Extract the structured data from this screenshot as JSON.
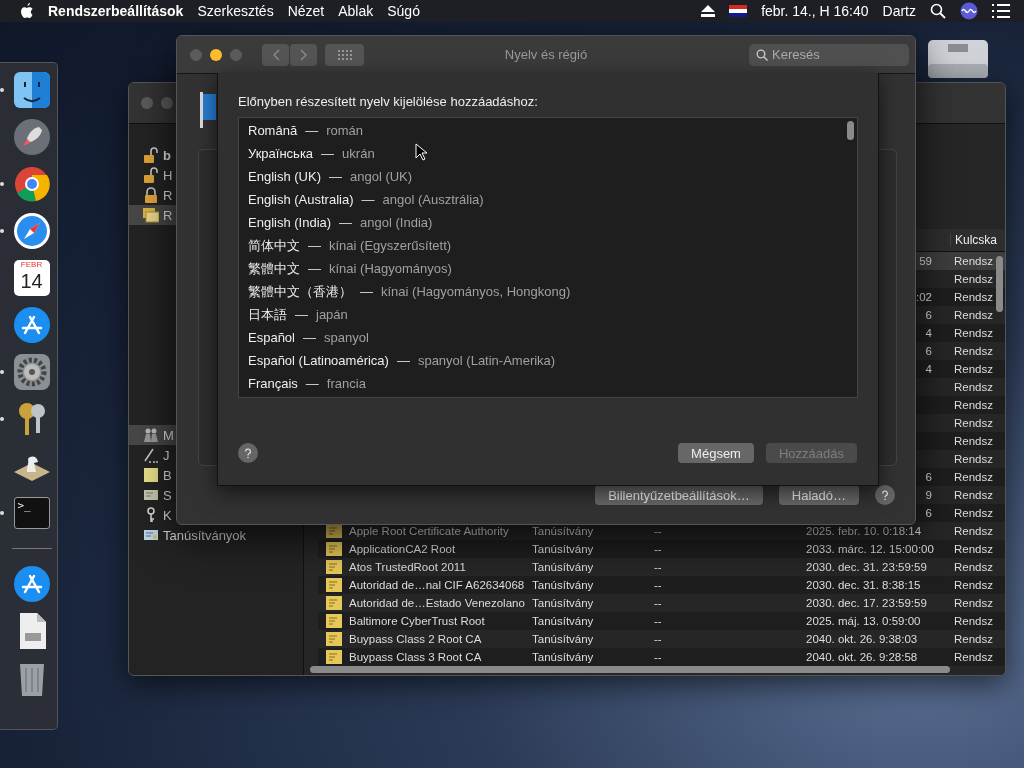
{
  "menu_bar": {
    "app": "Rendszerbeállítások",
    "menus": [
      "Szerkesztés",
      "Nézet",
      "Ablak",
      "Súgó"
    ],
    "clock": "febr. 14., H 16:40",
    "user": "Dartz"
  },
  "dock": [
    {
      "kind": "finder",
      "running": true
    },
    {
      "kind": "launchpad",
      "running": false
    },
    {
      "kind": "chrome",
      "running": true
    },
    {
      "kind": "safari",
      "running": true
    },
    {
      "kind": "calendar",
      "running": false,
      "month": "FEBR",
      "day": "14"
    },
    {
      "kind": "appstore",
      "running": false
    },
    {
      "kind": "sysprefs",
      "running": true
    },
    {
      "kind": "keychain",
      "running": true
    },
    {
      "kind": "chess",
      "running": false
    },
    {
      "kind": "terminal",
      "running": true,
      "glyph": ">_"
    },
    {
      "kind": "separator"
    },
    {
      "kind": "appstore",
      "running": false
    },
    {
      "kind": "document",
      "running": false
    },
    {
      "kind": "trash",
      "running": false
    }
  ],
  "keychain_window": {
    "keychains": [
      {
        "label": "b",
        "kind": "unlocked",
        "default": true,
        "selected": false
      },
      {
        "label": "H",
        "kind": "unlocked",
        "default": false,
        "selected": false
      },
      {
        "label": "R",
        "kind": "locked",
        "default": false,
        "selected": false
      },
      {
        "label": "R",
        "kind": "stack",
        "default": false,
        "selected": true
      }
    ],
    "categories": [
      {
        "label": "M",
        "kind": "people",
        "selected": true
      },
      {
        "label": "J",
        "kind": "pen",
        "selected": false
      },
      {
        "label": "B",
        "kind": "note",
        "selected": false
      },
      {
        "label": "S",
        "kind": "card",
        "selected": false
      },
      {
        "label": "K",
        "kind": "key",
        "selected": false
      },
      {
        "label": "Tanúsítványok",
        "kind": "certificate",
        "selected": false
      }
    ],
    "column_header": "Kulcska",
    "rows": [
      {
        "expires": "59",
        "keychain": "Rendsz",
        "selected": true
      },
      {
        "keychain": "Rendsz",
        "selected": false
      },
      {
        "expires": ":02",
        "keychain": "Rendsz",
        "selected": false
      },
      {
        "expires": "6",
        "keychain": "Rendsz",
        "selected": false
      },
      {
        "expires": "4",
        "keychain": "Rendsz",
        "selected": false
      },
      {
        "expires": "6",
        "keychain": "Rendsz",
        "selected": false
      },
      {
        "expires": "4",
        "keychain": "Rendsz",
        "selected": false
      },
      {
        "keychain": "Rendsz",
        "selected": false
      },
      {
        "keychain": "Rendsz",
        "selected": false
      },
      {
        "keychain": "Rendsz",
        "selected": false
      },
      {
        "keychain": "Rendsz",
        "selected": false
      },
      {
        "keychain": "Rendsz",
        "selected": false
      },
      {
        "expires": "6",
        "keychain": "Rendsz",
        "selected": false
      },
      {
        "expires": "9",
        "keychain": "Rendsz",
        "selected": false
      },
      {
        "expires": "6",
        "keychain": "Rendsz",
        "selected": false
      },
      {
        "name": "Apple Root Certificate Authority",
        "type": "Tanúsítvány",
        "modified": "--",
        "expires": "2025. febr. 10. 0:18:14",
        "keychain": "Rendsz",
        "selected": false
      },
      {
        "name": "ApplicationCA2 Root",
        "type": "Tanúsítvány",
        "modified": "--",
        "expires": "2033. márc. 12. 15:00:00",
        "keychain": "Rendsz",
        "selected": false
      },
      {
        "name": "Atos TrustedRoot 2011",
        "type": "Tanúsítvány",
        "modified": "--",
        "expires": "2030. dec. 31. 23:59:59",
        "keychain": "Rendsz",
        "selected": false
      },
      {
        "name": "Autoridad de…nal CIF A62634068",
        "type": "Tanúsítvány",
        "modified": "--",
        "expires": "2030. dec. 31. 8:38:15",
        "keychain": "Rendsz",
        "selected": false
      },
      {
        "name": "Autoridad de…Estado Venezolano",
        "type": "Tanúsítvány",
        "modified": "--",
        "expires": "2030. dec. 17. 23:59:59",
        "keychain": "Rendsz",
        "selected": false
      },
      {
        "name": "Baltimore CyberTrust Root",
        "type": "Tanúsítvány",
        "modified": "--",
        "expires": "2025. máj. 13. 0:59:00",
        "keychain": "Rendsz",
        "selected": false
      },
      {
        "name": "Buypass Class 2 Root CA",
        "type": "Tanúsítvány",
        "modified": "--",
        "expires": "2040. okt. 26. 9:38:03",
        "keychain": "Rendsz",
        "selected": false
      },
      {
        "name": "Buypass Class 3 Root CA",
        "type": "Tanúsítvány",
        "modified": "--",
        "expires": "2040. okt. 26. 9:28:58",
        "keychain": "Rendsz",
        "selected": false
      }
    ]
  },
  "prefs_window": {
    "title": "Nyelv és régió",
    "controls": [
      {
        "kind": "close",
        "enabled": false
      },
      {
        "kind": "minimize",
        "enabled": true
      },
      {
        "kind": "zoom",
        "enabled": false
      }
    ],
    "search": {
      "placeholder": "Keresés"
    },
    "buttons": [
      "Billentyűzetbeállítások…",
      "Haladó…"
    ]
  },
  "sheet": {
    "prompt": "Előnyben részesített nyelv kijelölése hozzáadáshoz:",
    "languages": [
      {
        "native": "Română",
        "separator": "—",
        "local": "román"
      },
      {
        "native": "Українська",
        "separator": "—",
        "local": "ukrán"
      },
      {
        "native": "English (UK)",
        "separator": "—",
        "local": "angol (UK)"
      },
      {
        "native": "English (Australia)",
        "separator": "—",
        "local": "angol (Ausztrália)"
      },
      {
        "native": "English (India)",
        "separator": "—",
        "local": "angol (India)"
      },
      {
        "native": "简体中文",
        "separator": "—",
        "local": "kínai (Egyszerűsített)"
      },
      {
        "native": "繁體中文",
        "separator": "—",
        "local": "kínai (Hagyományos)"
      },
      {
        "native": "繁體中文（香港）",
        "separator": "—",
        "local": "kínai (Hagyományos, Hongkong)"
      },
      {
        "native": "日本語",
        "separator": "—",
        "local": "japán"
      },
      {
        "native": "Español",
        "separator": "—",
        "local": "spanyol"
      },
      {
        "native": "Español (Latinoamérica)",
        "separator": "—",
        "local": "spanyol (Latin-Amerika)"
      },
      {
        "native": "Français",
        "separator": "—",
        "local": "francia"
      }
    ],
    "buttons": [
      {
        "label": "Mégsem",
        "disabled": false
      },
      {
        "label": "Hozzáadás",
        "disabled": true
      }
    ]
  }
}
